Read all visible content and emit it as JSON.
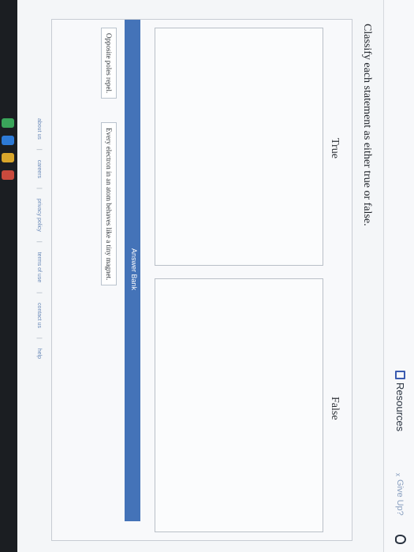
{
  "header": {
    "resources_label": "Resources",
    "give_up_label": "Give Up?"
  },
  "question": {
    "prompt": "Classify each statement as either true or false."
  },
  "categories": {
    "true_label": "True",
    "false_label": "False"
  },
  "answer_bank": {
    "title": "Answer Bank",
    "items": [
      "Opposite poles repel.",
      "Every electron in an atom behaves like a tiny magnet."
    ]
  },
  "footer": {
    "links": [
      "about us",
      "careers",
      "privacy policy",
      "terms of use",
      "contact us",
      "help"
    ]
  }
}
